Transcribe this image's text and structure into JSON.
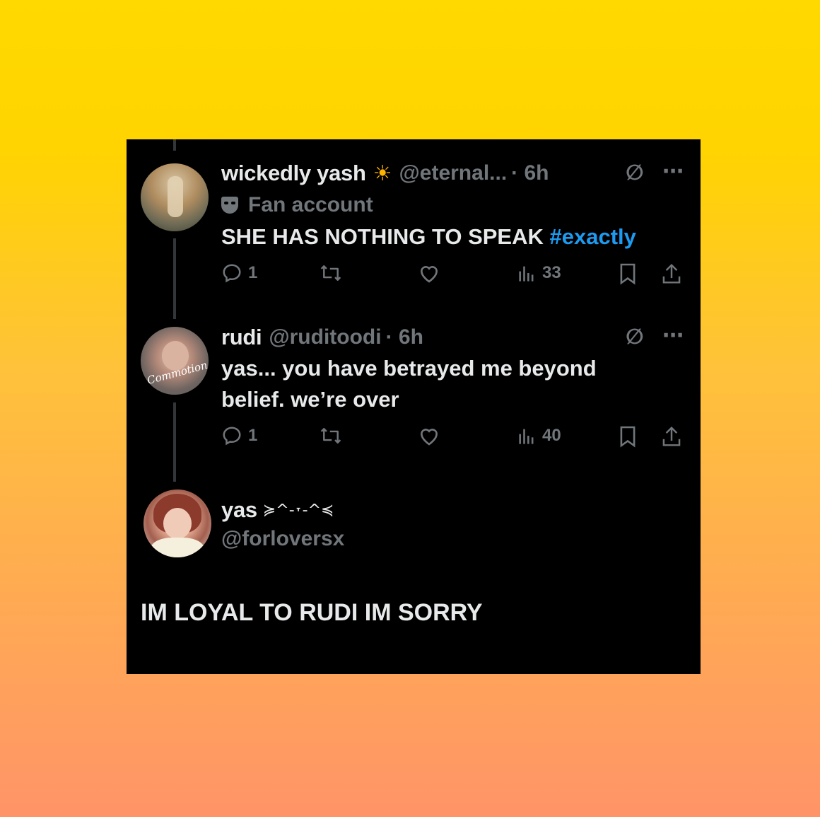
{
  "posts": [
    {
      "name": "wickedly yash",
      "name_icon": "sun-icon",
      "handle": "@eternal...",
      "time": "· 6h",
      "label": "Fan account",
      "text": "SHE HAS NOTHING TO SPEAK ",
      "hashtag": "#exactly",
      "replies": "1",
      "views": "33"
    },
    {
      "name": "rudi",
      "handle": "@ruditoodi",
      "time": "· 6h",
      "text_line1": "yas... you have betrayed me beyond",
      "text_line2": "belief. we’re over",
      "avatar_text": "Commotion",
      "replies": "1",
      "views": "40"
    }
  ],
  "reply": {
    "name": "yas",
    "name_suffix": "≽^-˕-^≼",
    "handle": "@forloversx",
    "text": "IM LOYAL TO RUDI IM SORRY"
  },
  "colors": {
    "background_top": "#ffd900",
    "background_bottom": "#ff9468",
    "card": "#000000",
    "hashtag": "#1d9bf0",
    "text": "#e7e9ea",
    "muted": "#71767b"
  }
}
